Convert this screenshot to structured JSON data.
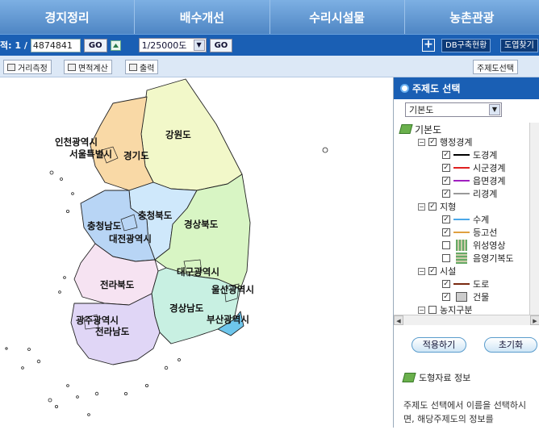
{
  "nav": {
    "tabs": [
      "경지정리",
      "배수개선",
      "수리시설물",
      "농촌관광"
    ]
  },
  "toolbar": {
    "page_label": "적: 1 /",
    "page_value": "4874841",
    "go_label": "GO",
    "scale_value": "1/25000도",
    "scale_go_label": "GO",
    "plus_label": "+",
    "db_label": "DB구축현황",
    "map_find_label": "도엽찾기"
  },
  "tools": {
    "distance_label": "거리측정",
    "area_label": "면적계산",
    "print_label": "출력",
    "theme_select_label": "주제도선택"
  },
  "map": {
    "regions": [
      "인천광역시",
      "서울특별시",
      "경기도",
      "강원도",
      "충청북도",
      "충청남도",
      "대전광역시",
      "경상북도",
      "대구광역시",
      "전라북도",
      "울산광역시",
      "경상남도",
      "부산광역시",
      "광주광역시",
      "전라남도"
    ],
    "colors": {
      "gyeonggi": "#f9d9a6",
      "gangwon": "#f2f8c9",
      "chungbuk": "#cfe8fb",
      "chungnam": "#b8d5f5",
      "gyeongbuk": "#d8f5c4",
      "jeonbuk": "#f6e3f2",
      "gyeongnam": "#c8f0e2",
      "jeonnam": "#e0d6f6",
      "busan": "#6ec6ec"
    }
  },
  "panel": {
    "title": "주제도 선택",
    "dropdown_value": "기본도",
    "tree": {
      "root": "기본도",
      "admin_group": "행정경계",
      "admin_items": [
        "도경계",
        "시군경계",
        "읍면경계",
        "리경계"
      ],
      "terrain_group": "지형",
      "terrain_items": [
        "수계",
        "등고선",
        "위성영상",
        "음영기복도"
      ],
      "facility_group": "시설",
      "facility_items": [
        "도로",
        "건물"
      ],
      "farm_group": "농지구분"
    },
    "apply_label": "적용하기",
    "reset_label": "초기화",
    "info_title": "도형자료 정보",
    "info_text": "주제도 선택에서 이름을 선택하시면, 해당주제도의 정보를"
  }
}
